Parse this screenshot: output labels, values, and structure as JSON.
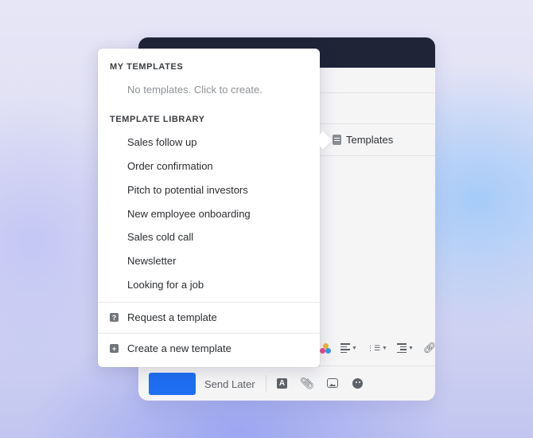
{
  "templates_menu": {
    "my_templates_title": "MY TEMPLATES",
    "empty_message": "No templates. Click to create.",
    "library_title": "TEMPLATE LIBRARY",
    "library_items": [
      "Sales follow up",
      "Order confirmation",
      "Pitch to potential investors",
      "New employee onboarding",
      "Sales cold call",
      "Newsletter",
      "Looking for a job"
    ],
    "request_label": "Request a template",
    "create_label": "Create a new template"
  },
  "compose": {
    "templates_button_label": "Templates",
    "send_later_label": "Send Later"
  },
  "icons": {
    "templates": "document-icon",
    "request": "question-icon",
    "create": "plus-icon"
  },
  "colors": {
    "header": "#1f2437",
    "send_button": "#1f6ef2"
  }
}
